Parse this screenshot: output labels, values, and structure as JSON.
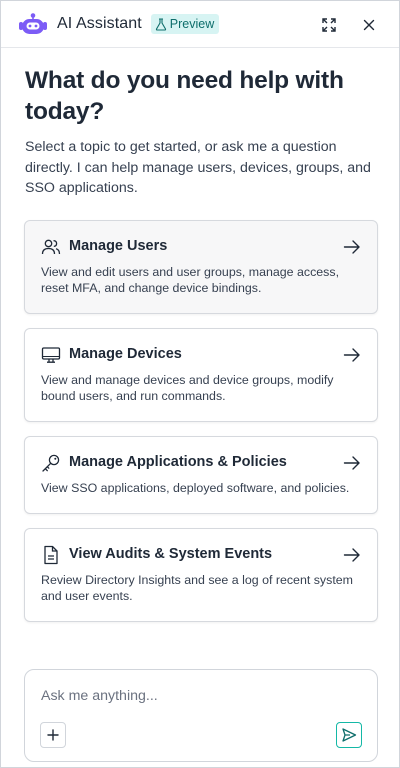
{
  "header": {
    "title": "AI Assistant",
    "badge": "Preview",
    "logo_icon": "robot-head-icon",
    "expand_icon": "expand-icon",
    "close_icon": "close-icon",
    "badge_color": "#d7f4f3",
    "logo_color": "#7c5cf6"
  },
  "main": {
    "heading": "What do you need help with today?",
    "intro": "Select a topic to get started, or ask me a question directly. I can help manage users, devices, groups, and SSO applications."
  },
  "cards": [
    {
      "icon": "users-icon",
      "title": "Manage Users",
      "description": "View and edit users and user groups, manage access, reset MFA, and change device bindings."
    },
    {
      "icon": "monitor-icon",
      "title": "Manage Devices",
      "description": "View and manage devices and device groups, modify bound users, and run commands."
    },
    {
      "icon": "key-icon",
      "title": "Manage Applications & Policies",
      "description": "View SSO applications, deployed software, and policies."
    },
    {
      "icon": "document-icon",
      "title": "View Audits & System Events",
      "description": "Review Directory Insights and see a log of recent system and user events."
    }
  ],
  "composer": {
    "placeholder": "Ask me anything...",
    "value": "",
    "add_icon": "plus-icon",
    "send_icon": "send-icon",
    "accent_color": "#14b8a6"
  }
}
